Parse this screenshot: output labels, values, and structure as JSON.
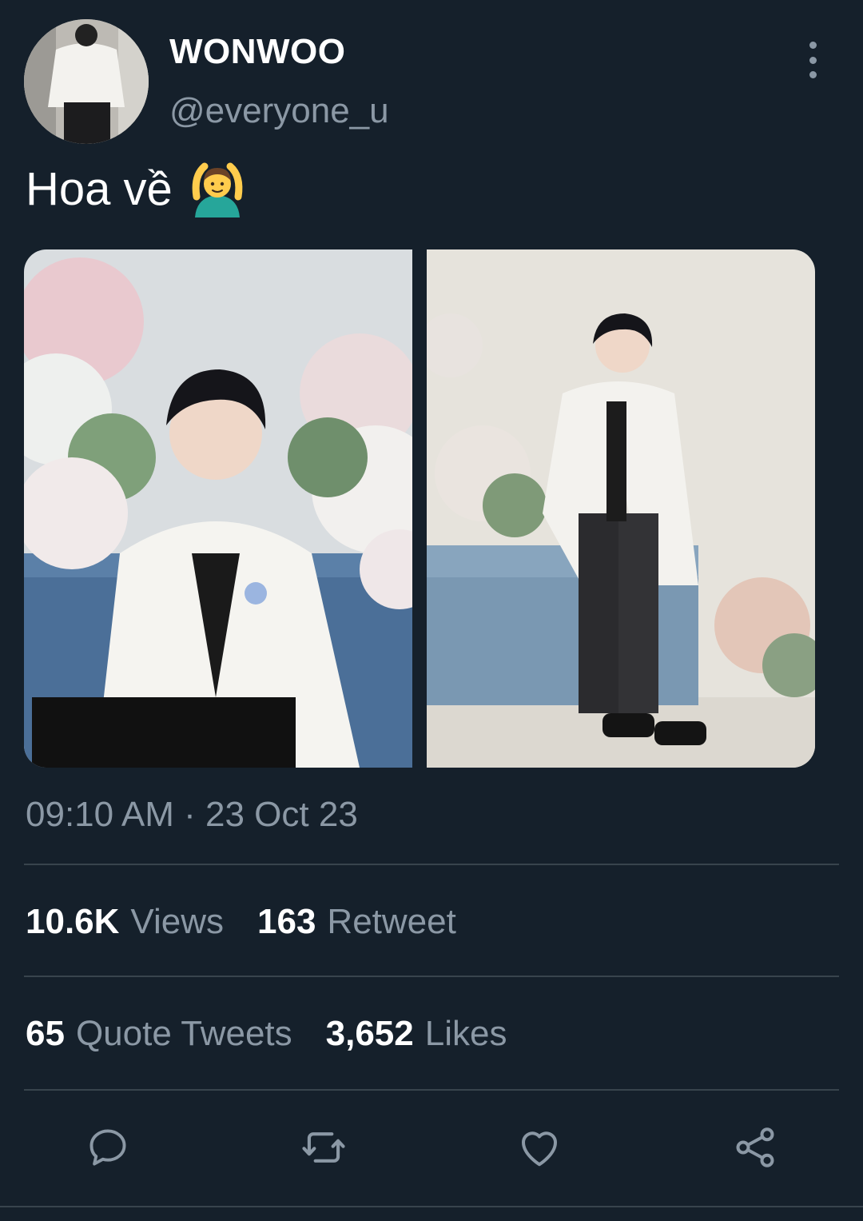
{
  "header": {
    "display_name": "WONWOO",
    "handle": "@everyone_u",
    "avatar_icon": "avatar-photo",
    "more_icon": "vertical-dots-icon"
  },
  "tweet": {
    "text": "Hoa về",
    "emoji": "🙆‍♂️",
    "timestamp": "09:10 AM · 23 Oct 23"
  },
  "stats": {
    "views_count": "10.6K",
    "views_label": "Views",
    "retweet_count": "163",
    "retweet_label": "Retweet",
    "quote_count": "65",
    "quote_label": "Quote Tweets",
    "likes_count": "3,652",
    "likes_label": "Likes"
  },
  "actions": [
    "reply-icon",
    "retweet-icon",
    "like-icon",
    "share-icon"
  ],
  "colors": {
    "background": "#15202b",
    "secondary_text": "#8b98a5",
    "divider": "#38444d"
  }
}
